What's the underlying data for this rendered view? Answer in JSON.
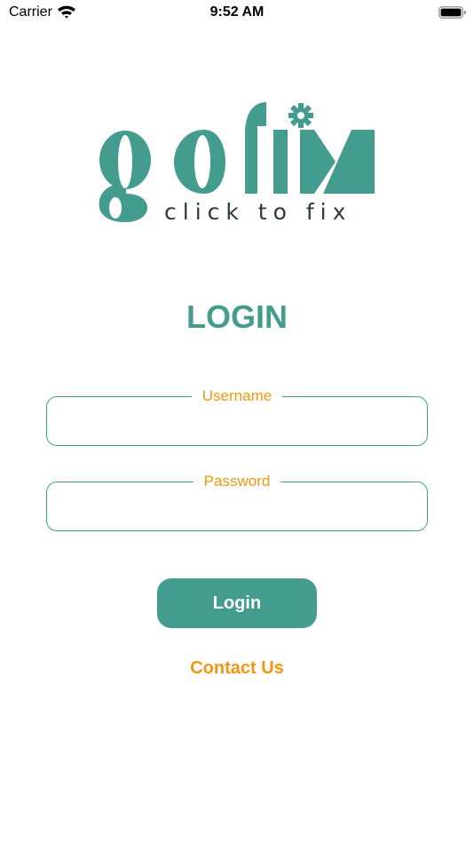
{
  "status_bar": {
    "carrier": "Carrier",
    "time": "9:52 AM",
    "wifi_icon": "wifi-icon",
    "battery_icon": "battery-icon"
  },
  "logo": {
    "wordmark": "gofix",
    "tagline": "click to fix",
    "brand_color": "#449c8f",
    "tagline_color": "#2a3a3f"
  },
  "login": {
    "title": "LOGIN",
    "username_label": "Username",
    "username_value": "",
    "password_label": "Password",
    "password_value": "",
    "login_button_label": "Login",
    "contact_label": "Contact Us"
  },
  "colors": {
    "primary": "#449c8f",
    "accent": "#f4950f",
    "background": "#ffffff"
  }
}
